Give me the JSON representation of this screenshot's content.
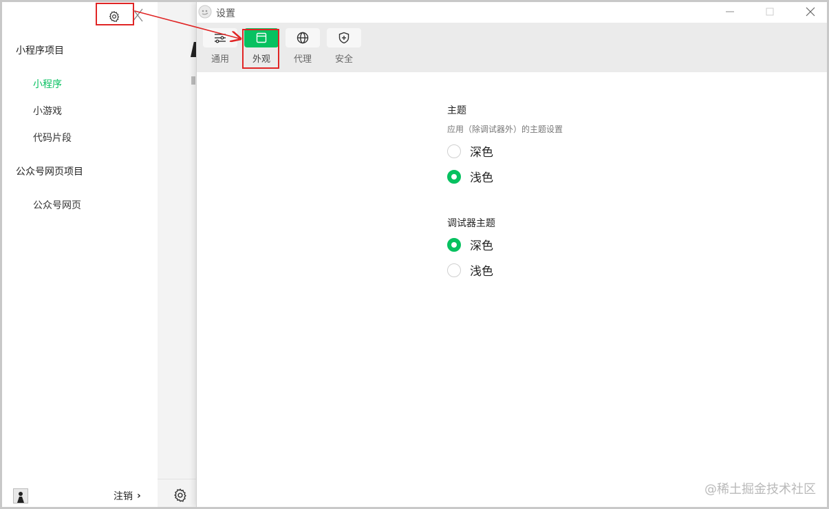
{
  "sidebar": {
    "sections": [
      {
        "label": "小程序项目",
        "items": [
          "小程序",
          "小游戏",
          "代码片段"
        ]
      },
      {
        "label": "公众号网页项目",
        "items": [
          "公众号网页"
        ]
      }
    ],
    "active_item": "小程序",
    "logout_label": "注销",
    "logout_chevron": "›"
  },
  "settings_window": {
    "title": "设置",
    "tabs": [
      {
        "label": "通用",
        "icon": "sliders-icon"
      },
      {
        "label": "外观",
        "icon": "window-icon"
      },
      {
        "label": "代理",
        "icon": "globe-icon"
      },
      {
        "label": "安全",
        "icon": "shield-icon"
      }
    ],
    "active_tab": "外观",
    "theme": {
      "title": "主题",
      "description": "应用（除调试器外）的主题设置",
      "options": [
        {
          "label": "深色",
          "checked": false
        },
        {
          "label": "浅色",
          "checked": true
        }
      ]
    },
    "debugger_theme": {
      "title": "调试器主题",
      "options": [
        {
          "label": "深色",
          "checked": true
        },
        {
          "label": "浅色",
          "checked": false
        }
      ]
    }
  },
  "watermark": "@稀土掘金技术社区",
  "colors": {
    "accent": "#07c160",
    "annotation": "#e02424",
    "toolbar_bg": "#ebebeb",
    "middle_bg": "#f3f3f3"
  }
}
